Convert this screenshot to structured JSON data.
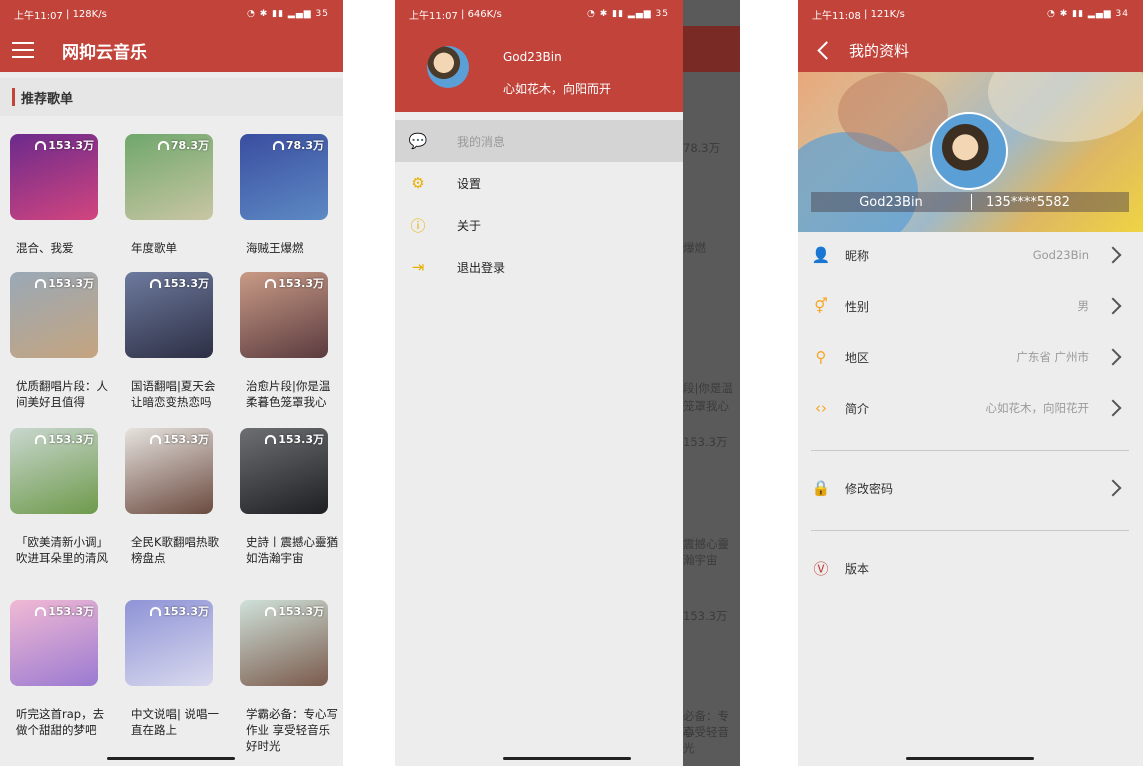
{
  "phone1": {
    "status": {
      "time": "上午11:07",
      "speed": "128K/s",
      "battery": "35"
    },
    "app_title": "网抑云音乐",
    "section_title": "推荐歌单",
    "playlists": [
      {
        "name": "混合、我爱",
        "plays": "153.3万",
        "c1": "#6b2a8c",
        "c2": "#d2457f"
      },
      {
        "name": "年度歌单",
        "plays": "78.3万",
        "c1": "#6fa76b",
        "c2": "#c9c6a4"
      },
      {
        "name": "海贼王爆燃",
        "plays": "78.3万",
        "c1": "#3a4da0",
        "c2": "#5d8ac4"
      },
      {
        "name": "优质翻唱片段：人间美好且值得",
        "plays": "153.3万",
        "c1": "#9aa9b7",
        "c2": "#c4a47f"
      },
      {
        "name": "国语翻唱|夏天会让暗恋变热恋吗",
        "plays": "153.3万",
        "c1": "#6d7a9e",
        "c2": "#2d2f44"
      },
      {
        "name": "治愈片段|你是温柔暮色笼罩我心",
        "plays": "153.3万",
        "c1": "#c99b86",
        "c2": "#5b3b3f"
      },
      {
        "name": "「欧美清新小调」吹进耳朵里的清风",
        "plays": "153.3万",
        "c1": "#c9d7cf",
        "c2": "#6e9a4b"
      },
      {
        "name": "全民K歌翻唱热歌榜盘点",
        "plays": "153.3万",
        "c1": "#e6e3df",
        "c2": "#6b4a3f"
      },
      {
        "name": "史詩丨震撼心靈猶如浩瀚宇宙",
        "plays": "153.3万",
        "c1": "#6d6f72",
        "c2": "#1d1f22"
      },
      {
        "name": "听完这首rap，去做个甜甜的梦吧",
        "plays": "153.3万",
        "c1": "#f1b9d4",
        "c2": "#9a7ad1"
      },
      {
        "name": "中文说唱| 说唱一直在路上",
        "plays": "153.3万",
        "c1": "#8e93d6",
        "c2": "#d9d9ee"
      },
      {
        "name": "学霸必备：专心写作业 享受轻音乐好时光",
        "plays": "153.3万",
        "c1": "#cfe1d9",
        "c2": "#7a5a4c"
      }
    ]
  },
  "phone2": {
    "status": {
      "time": "上午11:07",
      "speed": "646K/s",
      "battery": "35"
    },
    "user": {
      "name": "God23Bin",
      "signature": "心如花木，向阳而开"
    },
    "menu": [
      {
        "label": "我的消息",
        "icon": "message-icon",
        "glyph": "💬"
      },
      {
        "label": "设置",
        "icon": "settings-icon",
        "glyph": "⚙"
      },
      {
        "label": "关于",
        "icon": "info-icon",
        "glyph": "ⓘ"
      },
      {
        "label": "退出登录",
        "icon": "logout-icon",
        "glyph": "⇥"
      }
    ],
    "peek": [
      "78.3万",
      "爆燃",
      "段|你是温",
      "笼罩我心",
      "153.3万",
      "震撼心靈",
      "瀚宇宙",
      "153.3万",
      "必备：专心",
      "享受轻音",
      "光"
    ]
  },
  "phone3": {
    "status": {
      "time": "上午11:08",
      "speed": "121K/s",
      "battery": "34"
    },
    "title": "我的资料",
    "nickname": "God23Bin",
    "phone": "135****5582",
    "rows": [
      {
        "label": "昵称",
        "value": "God23Bin",
        "icon": "person-icon",
        "glyph": "👤"
      },
      {
        "label": "性别",
        "value": "男",
        "icon": "gender-icon",
        "glyph": "⚥"
      },
      {
        "label": "地区",
        "value": "广东省 广州市",
        "icon": "location-icon",
        "glyph": "⚲"
      },
      {
        "label": "简介",
        "value": "心如花木，向阳花开",
        "icon": "intro-icon",
        "glyph": "‹›"
      }
    ],
    "password_label": "修改密码",
    "version_label": "版本"
  },
  "colors": {
    "accent": "#c1433a",
    "icon_yellow": "#f5a623"
  }
}
